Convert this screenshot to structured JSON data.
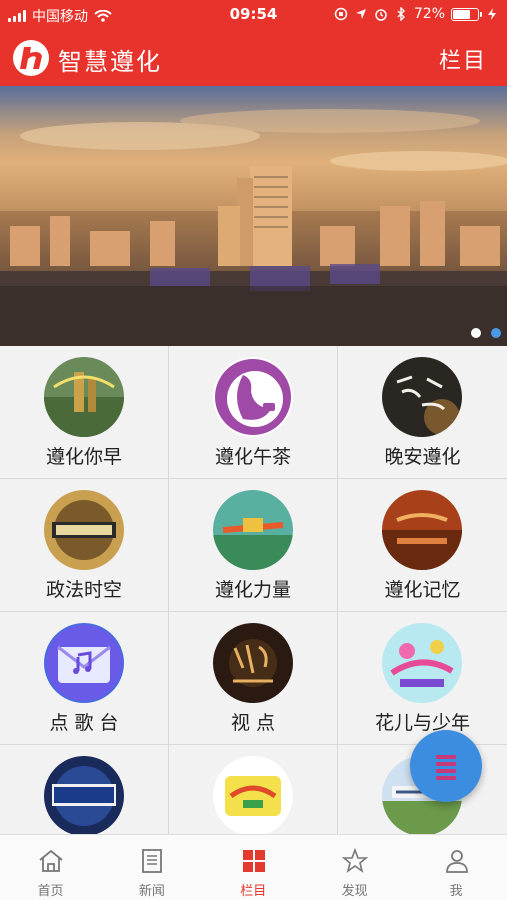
{
  "status_bar": {
    "carrier": "中国移动",
    "time": "09:54",
    "battery_level": "72%",
    "battery_fraction": 0.72
  },
  "header": {
    "title": "智慧遵化",
    "menu_label": "栏目",
    "logo_icon": "app-logo-icon"
  },
  "banner": {
    "slide_count": 2,
    "active_slide": 2
  },
  "grid": {
    "items": [
      {
        "label": "遵化你早",
        "icon": "morning-thumbnail"
      },
      {
        "label": "遵化午茶",
        "icon": "afternoon-tea-thumbnail"
      },
      {
        "label": "晚安遵化",
        "icon": "evening-thumbnail"
      },
      {
        "label": "政法时空",
        "icon": "law-thumbnail"
      },
      {
        "label": "遵化力量",
        "icon": "power-thumbnail"
      },
      {
        "label": "遵化记忆",
        "icon": "memory-thumbnail"
      },
      {
        "label": "点 歌 台",
        "icon": "music-mail-thumbnail"
      },
      {
        "label": "视 点",
        "icon": "viewpoint-thumbnail"
      },
      {
        "label": "花儿与少年",
        "icon": "flowers-youth-thumbnail"
      },
      {
        "label": "",
        "icon": "traffic-police-thumbnail"
      },
      {
        "label": "",
        "icon": "life-thumbnail"
      },
      {
        "label": "",
        "icon": "beautiful-zunhua-thumbnail"
      }
    ]
  },
  "fab": {
    "icon": "menu-bars-icon"
  },
  "tabbar": {
    "tabs": [
      {
        "label": "首页",
        "icon": "home-icon"
      },
      {
        "label": "新闻",
        "icon": "news-icon"
      },
      {
        "label": "栏目",
        "icon": "grid-icon",
        "active": true
      },
      {
        "label": "发现",
        "icon": "discover-icon"
      },
      {
        "label": "我",
        "icon": "user-icon"
      }
    ]
  },
  "colors": {
    "brand_red": "#e8332c",
    "fab_blue": "#3c8de0",
    "active_tab": "#e23a2e"
  }
}
